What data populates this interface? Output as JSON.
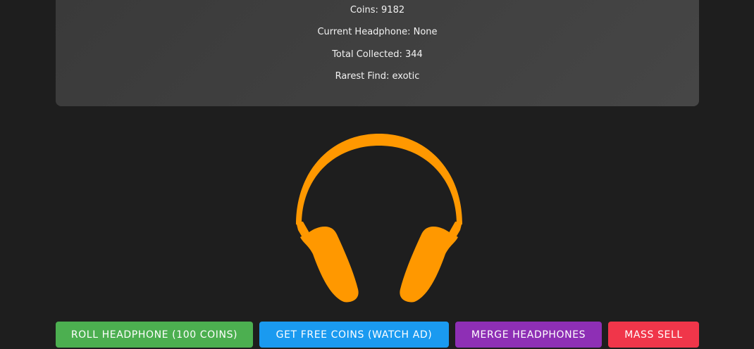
{
  "stats": {
    "coins": "Coins: 9182",
    "current_headphone": "Current Headphone: None",
    "total_collected": "Total Collected: 344",
    "rarest_find": "Rarest Find: exotic"
  },
  "display": {
    "icon": "headphones-icon",
    "icon_color": "#ff9800"
  },
  "actions": {
    "roll": {
      "label": "ROLL HEADPHONE (100 COINS)",
      "color": "#4caf50"
    },
    "free_coins": {
      "label": "GET FREE COINS (WATCH AD)",
      "color": "#1a9af0"
    },
    "merge": {
      "label": "MERGE HEADPHONES",
      "color": "#8e2fb5"
    },
    "mass_sell": {
      "label": "MASS SELL",
      "color": "#f0364a"
    }
  }
}
